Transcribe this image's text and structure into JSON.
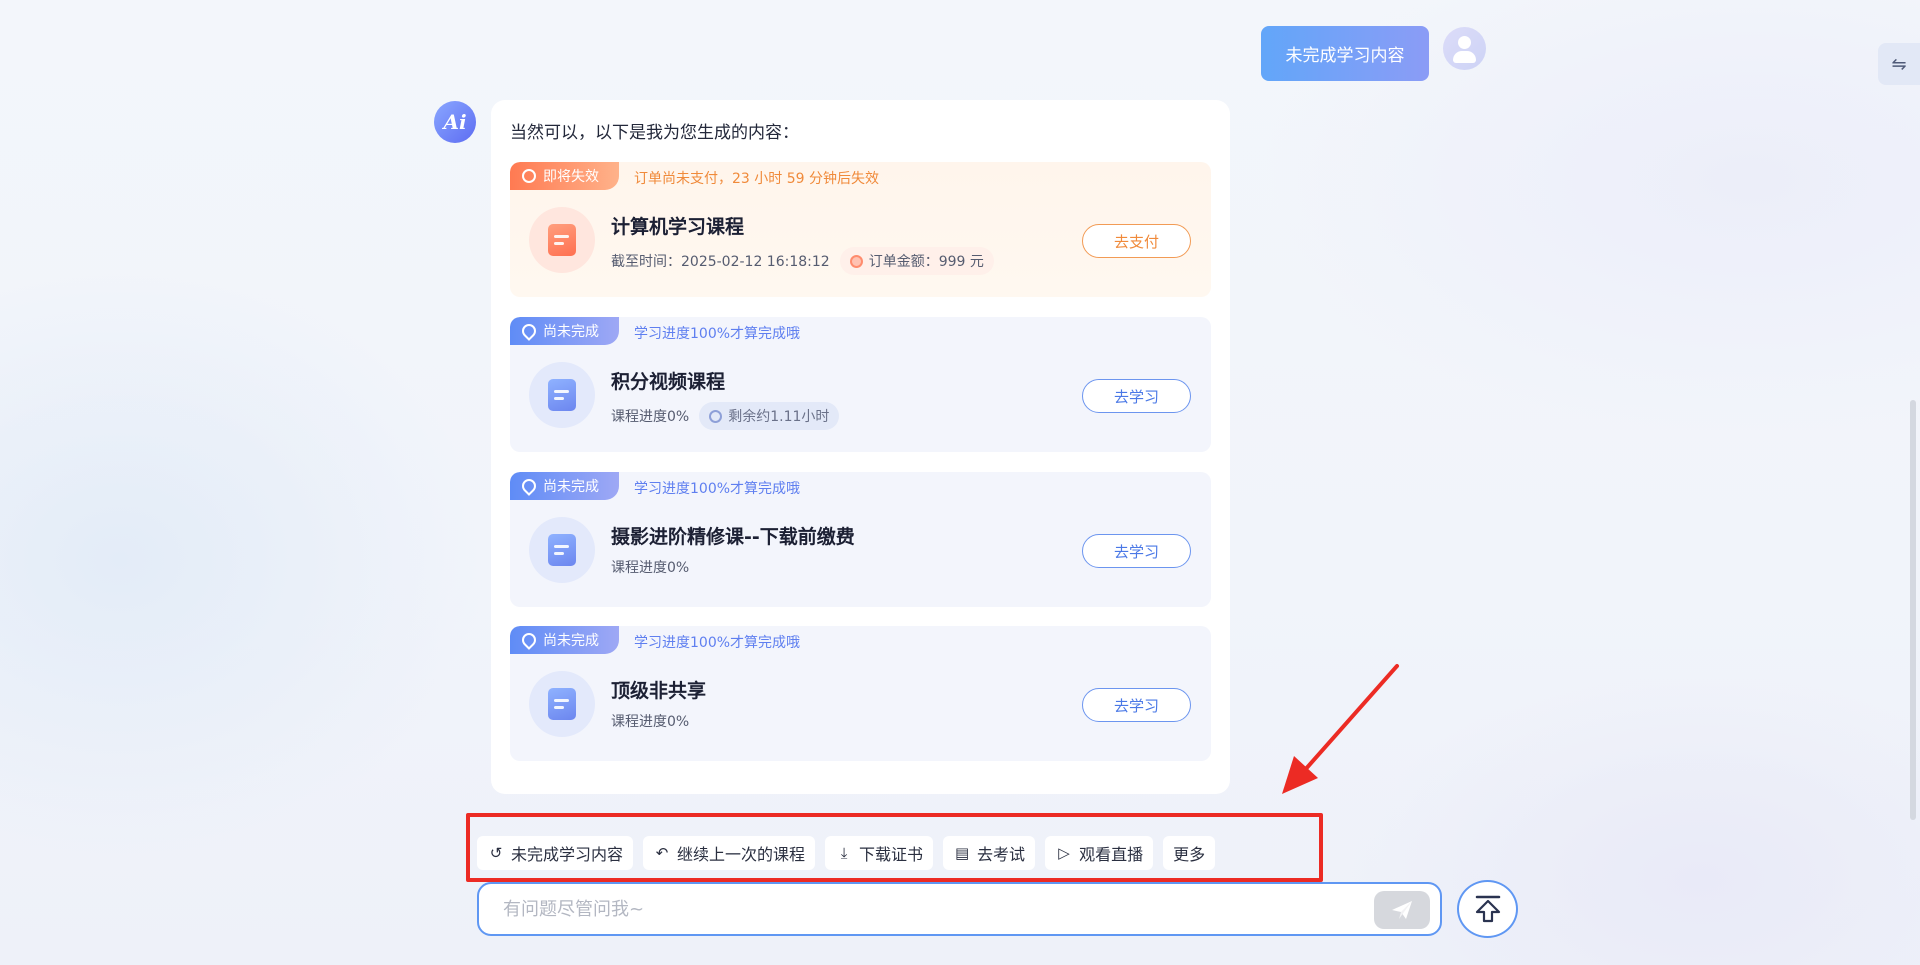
{
  "user_message": {
    "text": "未完成学习内容",
    "avatar": "user-avatar-icon"
  },
  "side_toggle": {
    "icon": "swap-arrows-icon",
    "glyph": "⇋"
  },
  "ai": {
    "avatar_text": "Ai",
    "intro": "当然可以，以下是我为您生成的内容：",
    "courses": [
      {
        "status": "即将失效",
        "status_color": "#ff7a52",
        "note": "订单尚未支付，23 小时 59 分钟后失效",
        "title": "计算机学习课程",
        "meta_text": "截至时间：2025-02-12 16:18:12",
        "chip": "订单金额：999 元",
        "button": "去支付",
        "variant": "orange"
      },
      {
        "status": "尚未完成",
        "status_color": "#5f8cf6",
        "note": "学习进度100%才算完成哦",
        "title": "积分视频课程",
        "meta_text": "课程进度0%",
        "chip": "剩余约1.11小时",
        "button": "去学习",
        "variant": "blue"
      },
      {
        "status": "尚未完成",
        "status_color": "#5f8cf6",
        "note": "学习进度100%才算完成哦",
        "title": "摄影进阶精修课--下载前缴费",
        "meta_text": "课程进度0%",
        "button": "去学习",
        "variant": "blue"
      },
      {
        "status": "尚未完成",
        "status_color": "#5f8cf6",
        "note": "学习进度100%才算完成哦",
        "title": "顶级非共享",
        "meta_text": "课程进度0%",
        "button": "去学习",
        "variant": "blue"
      }
    ]
  },
  "shortcuts": [
    {
      "label": "未完成学习内容",
      "icon": "history-icon",
      "glyph": "↺"
    },
    {
      "label": "继续上一次的课程",
      "icon": "undo-icon",
      "glyph": "↶"
    },
    {
      "label": "下载证书",
      "icon": "download-icon",
      "glyph": "⤓"
    },
    {
      "label": "去考试",
      "icon": "exam-icon",
      "glyph": "▤"
    },
    {
      "label": "观看直播",
      "icon": "play-icon",
      "glyph": "▷"
    },
    {
      "label": "更多",
      "icon": "",
      "glyph": ""
    }
  ],
  "input": {
    "placeholder": "有问题尽管问我~",
    "value": ""
  },
  "colors": {
    "accent": "#5f97f3",
    "warning": "#f08a3a",
    "annotation": "#ec2b24"
  }
}
